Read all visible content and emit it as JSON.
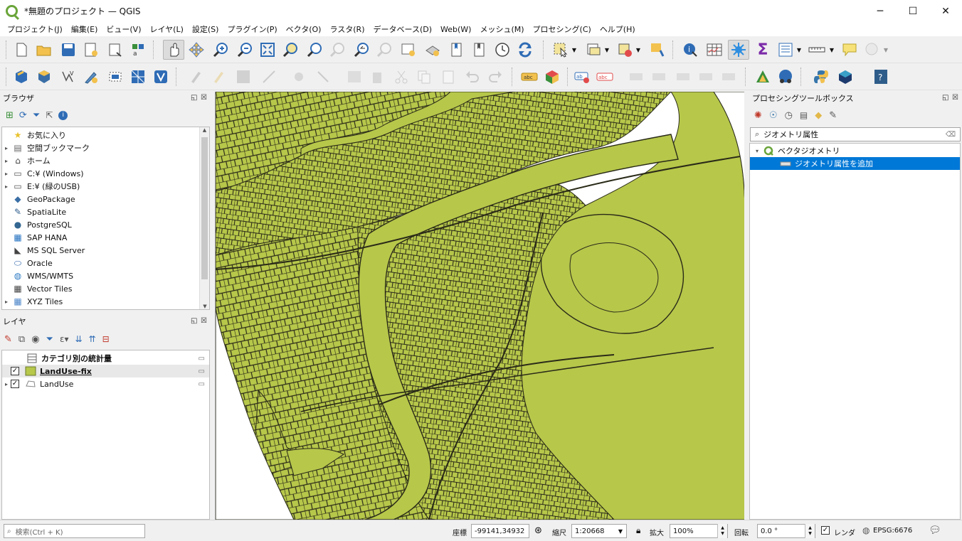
{
  "window": {
    "title": "*無題のプロジェクト — QGIS",
    "minimize": "─",
    "maximize": "☐",
    "close": "✕"
  },
  "menu": [
    "プロジェクト(J)",
    "編集(E)",
    "ビュー(V)",
    "レイヤ(L)",
    "設定(S)",
    "プラグイン(P)",
    "ベクタ(O)",
    "ラスタ(R)",
    "データベース(D)",
    "Web(W)",
    "メッシュ(M)",
    "プロセシング(C)",
    "ヘルプ(H)"
  ],
  "browser": {
    "title": "ブラウザ",
    "items": [
      {
        "label": "お気に入り",
        "icon": "star-icon",
        "glyph": "★",
        "color": "#e8c22c",
        "arrow": ""
      },
      {
        "label": "空間ブックマーク",
        "icon": "bookmark-icon",
        "glyph": "▤",
        "color": "#666",
        "arrow": "▸"
      },
      {
        "label": "ホーム",
        "icon": "home-icon",
        "glyph": "⌂",
        "color": "#444",
        "arrow": "▸"
      },
      {
        "label": "C:¥ (Windows)",
        "icon": "drive-icon",
        "glyph": "▭",
        "color": "#555",
        "arrow": "▸"
      },
      {
        "label": "E:¥ (緑のUSB)",
        "icon": "drive-icon",
        "glyph": "▭",
        "color": "#555",
        "arrow": "▸"
      },
      {
        "label": "GeoPackage",
        "icon": "geopackage-icon",
        "glyph": "◆",
        "color": "#3a6ea5",
        "arrow": ""
      },
      {
        "label": "SpatiaLite",
        "icon": "spatialite-icon",
        "glyph": "✎",
        "color": "#2f5d8a",
        "arrow": ""
      },
      {
        "label": "PostgreSQL",
        "icon": "postgresql-icon",
        "glyph": "●",
        "color": "#336791",
        "arrow": ""
      },
      {
        "label": "SAP HANA",
        "icon": "sap-hana-icon",
        "glyph": "▦",
        "color": "#1f6fbf",
        "arrow": ""
      },
      {
        "label": "MS SQL Server",
        "icon": "mssql-icon",
        "glyph": "◣",
        "color": "#444",
        "arrow": ""
      },
      {
        "label": "Oracle",
        "icon": "oracle-icon",
        "glyph": "⬭",
        "color": "#2a5fa8",
        "arrow": ""
      },
      {
        "label": "WMS/WMTS",
        "icon": "globe-icon",
        "glyph": "◍",
        "color": "#2e7bc4",
        "arrow": ""
      },
      {
        "label": "Vector Tiles",
        "icon": "vector-tiles-icon",
        "glyph": "▦",
        "color": "#444",
        "arrow": ""
      },
      {
        "label": "XYZ Tiles",
        "icon": "xyz-tiles-icon",
        "glyph": "▦",
        "color": "#4a84c8",
        "arrow": "▸"
      }
    ]
  },
  "layers": {
    "title": "レイヤ",
    "items": [
      {
        "label": "カテゴリ別の統計量",
        "icon": "table-icon",
        "checked": false,
        "bold": true,
        "underline": false,
        "arrow": ""
      },
      {
        "label": "LandUse-fix",
        "icon": "polygon-fill-icon",
        "checked": true,
        "bold": true,
        "underline": true,
        "arrow": ""
      },
      {
        "label": "LandUse",
        "icon": "polygon-outline-icon",
        "checked": true,
        "bold": false,
        "underline": false,
        "arrow": "▸"
      }
    ]
  },
  "toolbox": {
    "title": "プロセシングツールボックス",
    "search_value": "ジオメトリ属性",
    "group": "ベクタジオメトリ",
    "tool": "ジオメトリ属性を追加"
  },
  "status": {
    "search_placeholder": "検索(Ctrl + K)",
    "coord_label": "座標",
    "coord_value": "-99141,34932",
    "scale_label": "縮尺",
    "scale_value": "1:20668",
    "magnify_label": "拡大",
    "magnify_value": "100%",
    "rotation_label": "回転",
    "rotation_value": "0.0 °",
    "render_label": "レンダ",
    "render_checked": true,
    "crs": "EPSG:6676"
  },
  "colors": {
    "map_fill": "#b6c74a",
    "map_stroke": "#2a2a18",
    "selection": "#0078d7",
    "qgis_green": "#6aa53a"
  }
}
